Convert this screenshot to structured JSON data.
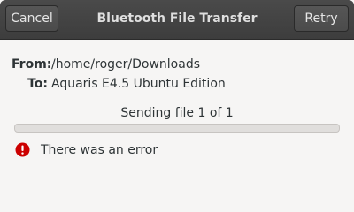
{
  "header": {
    "title": "Bluetooth File Transfer",
    "cancel_label": "Cancel",
    "retry_label": "Retry"
  },
  "transfer": {
    "from_label": "From:",
    "from_value": "/home/roger/Downloads",
    "to_label": "To:",
    "to_value": "Aquaris E4.5 Ubuntu Edition",
    "status": "Sending file 1 of 1",
    "progress_fraction": 0
  },
  "error": {
    "icon": "error-icon",
    "message": "There was an error"
  },
  "colors": {
    "headerbar": "#3d3d3d",
    "window_bg": "#f6f5f4",
    "error_red": "#cc0000",
    "progress_accent": "#e95420"
  }
}
